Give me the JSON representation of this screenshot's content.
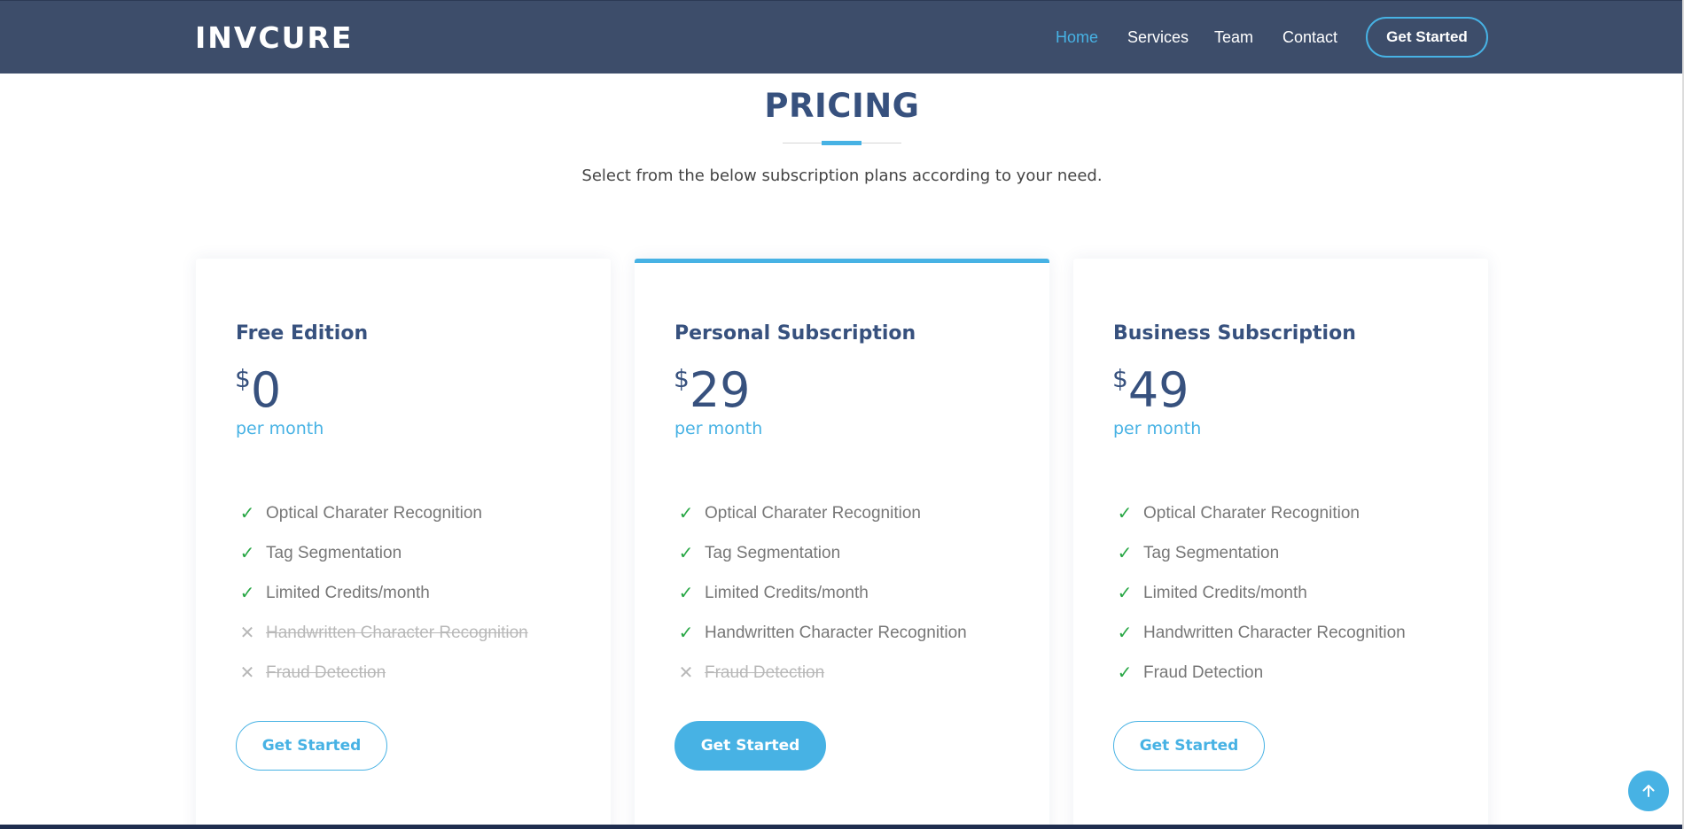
{
  "header": {
    "logo": "INVCURE",
    "nav": [
      "Home",
      "Services",
      "Team",
      "Contact"
    ],
    "active": "Home",
    "cta": "Get Started"
  },
  "section": {
    "title": "PRICING",
    "subtitle": "Select from the below subscription plans according to your need."
  },
  "plans": [
    {
      "name": "Free Edition",
      "currency": "$",
      "amount": "0",
      "period": "per month",
      "features": [
        {
          "text": "Optical Charater Recognition",
          "included": true
        },
        {
          "text": "Tag Segmentation",
          "included": true
        },
        {
          "text": "Limited Credits/month",
          "included": true
        },
        {
          "text": "Handwritten Character Recognition",
          "included": false
        },
        {
          "text": "Fraud Detection",
          "included": false
        }
      ],
      "button": "Get Started"
    },
    {
      "name": "Personal Subscription",
      "currency": "$",
      "amount": "29",
      "period": "per month",
      "features": [
        {
          "text": "Optical Charater Recognition",
          "included": true
        },
        {
          "text": "Tag Segmentation",
          "included": true
        },
        {
          "text": "Limited Credits/month",
          "included": true
        },
        {
          "text": "Handwritten Character Recognition",
          "included": true
        },
        {
          "text": "Fraud Detection",
          "included": false
        }
      ],
      "button": "Get Started"
    },
    {
      "name": "Business Subscription",
      "currency": "$",
      "amount": "49",
      "period": "per month",
      "features": [
        {
          "text": "Optical Charater Recognition",
          "included": true
        },
        {
          "text": "Tag Segmentation",
          "included": true
        },
        {
          "text": "Limited Credits/month",
          "included": true
        },
        {
          "text": "Handwritten Character Recognition",
          "included": true
        },
        {
          "text": "Fraud Detection",
          "included": true
        }
      ],
      "button": "Get Started"
    }
  ],
  "icons": {
    "check": "check-icon",
    "cross": "cross-icon",
    "back_to_top": "arrow-up-icon"
  },
  "colors": {
    "header_bg": "#3d4d6a",
    "accent": "#47b2e4",
    "heading": "#37517e",
    "check": "#28a745"
  }
}
